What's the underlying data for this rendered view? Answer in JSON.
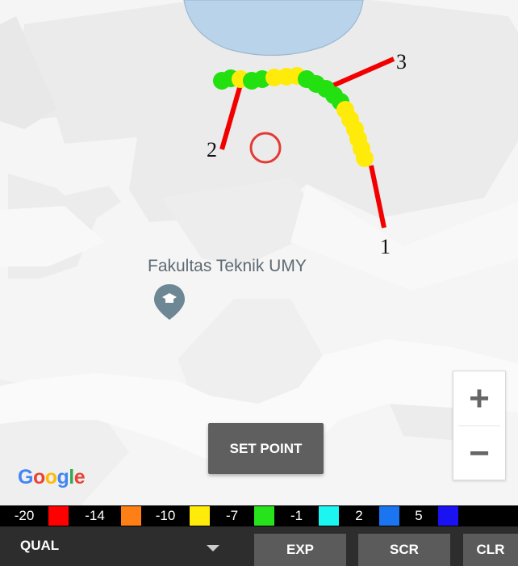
{
  "map": {
    "place_label": "Fakultas Teknik UMY",
    "marker_icon": "education-pin-icon",
    "target_icon": "red-circle-target-icon",
    "callouts": [
      "1",
      "2",
      "3"
    ],
    "measurement_dot_colors": [
      "#23e010",
      "#ffeb0a"
    ],
    "attribution": "Google"
  },
  "zoom": {
    "in_label": "+",
    "out_label": "−"
  },
  "set_point": {
    "label": "SET POINT"
  },
  "legend": [
    {
      "value": "-20",
      "color": "#ff0000"
    },
    {
      "value": "-14",
      "color": "#ff7f17"
    },
    {
      "value": "-10",
      "color": "#ffeb0a"
    },
    {
      "value": "-7",
      "color": "#26e31c"
    },
    {
      "value": "-1",
      "color": "#1cf5f0"
    },
    {
      "value": "2",
      "color": "#1b74f0"
    },
    {
      "value": "5",
      "color": "#1a12f0"
    }
  ],
  "bottom_bar": {
    "mode_select": "QUAL",
    "exp_label": "EXP",
    "scr_label": "SCR",
    "clr_label": "CLR"
  }
}
